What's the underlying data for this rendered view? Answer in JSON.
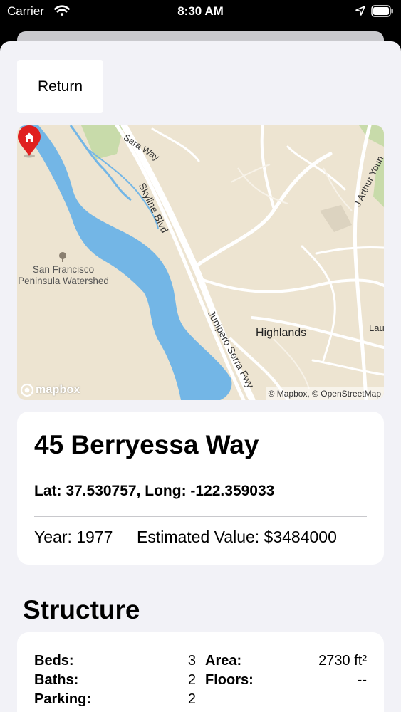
{
  "status_bar": {
    "carrier": "Carrier",
    "time": "8:30 AM",
    "wifi_icon": "wifi-icon",
    "location_icon": "location-arrow-icon",
    "battery_icon": "battery-full-icon"
  },
  "nav": {
    "return_label": "Return"
  },
  "map": {
    "labels": {
      "sara_way": "Sara Way",
      "skyline_blvd": "Skyline Blvd",
      "j_arthur_young": "J Arthur Youn",
      "watershed_line1": "San Francisco",
      "watershed_line2": "Peninsula Watershed",
      "highlands": "Highlands",
      "junipero_serra": "Junipero Serra Fwy",
      "lau": "Lau"
    },
    "logo_text": "mapbox",
    "attribution": "© Mapbox, © OpenStreetMap",
    "pin_icon": "home-map-pin-icon",
    "colors": {
      "land": "#ede4d1",
      "water": "#73b6e6",
      "park": "#c8dbaa",
      "pin": "#e0201f"
    }
  },
  "property": {
    "address": "45 Berryessa Way",
    "coordinates": "Lat: 37.530757, Long: -122.359033",
    "year": "Year: 1977",
    "estimated_value": "Estimated Value: $3484000"
  },
  "structure": {
    "title": "Structure",
    "beds_label": "Beds:",
    "beds_value": "3",
    "baths_label": "Baths:",
    "baths_value": "2",
    "parking_label": "Parking:",
    "parking_value": "2",
    "area_label": "Area:",
    "area_value": "2730 ft²",
    "floors_label": "Floors:",
    "floors_value": "--"
  }
}
